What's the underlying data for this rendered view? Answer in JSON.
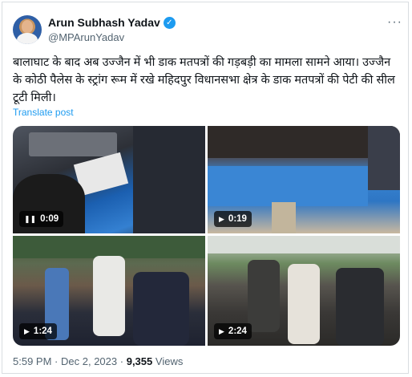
{
  "tweet": {
    "display_name": "Arun Subhash Yadav",
    "handle": "@MPArunYadav",
    "text": "बालाघाट के बाद अब उज्जैन में भी डाक मतपत्रों की गड़बड़ी का मामला सामने आया। उज्जैन के कोठी पैलेस के स्ट्रांग रूम में रखे महिदपुर विधानसभा क्षेत्र के डाक मतपत्रों की पेटी की सील टूटी मिली।",
    "translate_label": "Translate post",
    "time": "5:59 PM",
    "date": "Dec 2, 2023",
    "views_count": "9,355",
    "views_label": "Views",
    "separator": "·"
  },
  "media": [
    {
      "duration": "0:09",
      "state": "paused",
      "icon": "pause-icon"
    },
    {
      "duration": "0:19",
      "state": "play",
      "icon": "play-icon"
    },
    {
      "duration": "1:24",
      "state": "play",
      "icon": "play-icon"
    },
    {
      "duration": "2:24",
      "state": "play",
      "icon": "play-icon"
    }
  ],
  "colors": {
    "accent": "#1d9bf0",
    "secondary_text": "#536471",
    "primary_text": "#0f1419"
  }
}
